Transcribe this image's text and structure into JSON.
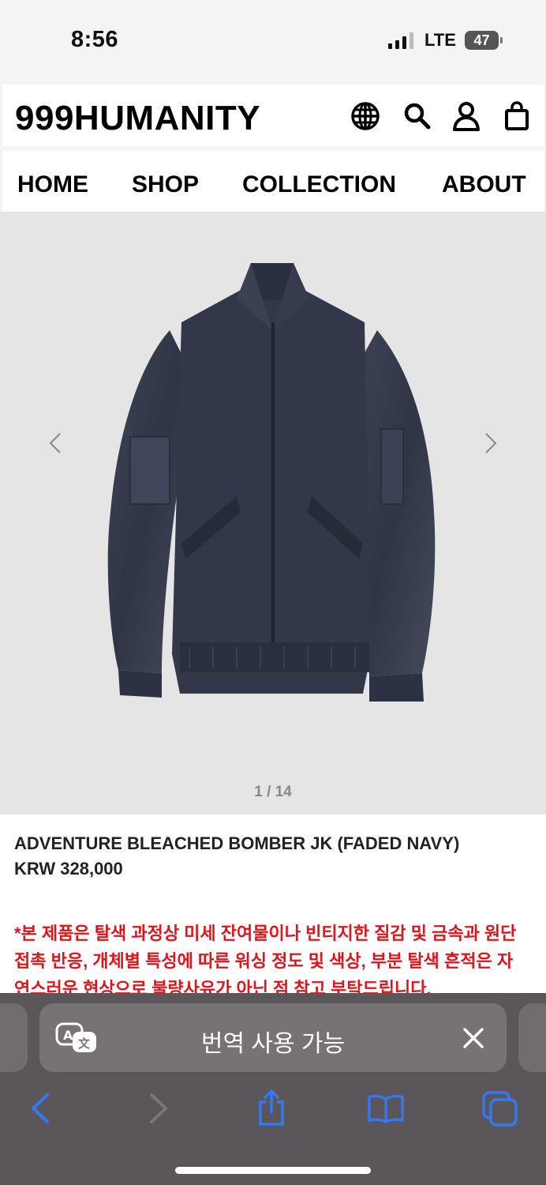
{
  "status": {
    "time": "8:56",
    "network": "LTE",
    "battery": "47"
  },
  "header": {
    "logo": "999HUMANITY",
    "icons": [
      "globe-icon",
      "search-icon",
      "account-icon",
      "bag-icon"
    ]
  },
  "nav": {
    "items": [
      "HOME",
      "SHOP",
      "COLLECTION",
      "ABOUT"
    ]
  },
  "gallery": {
    "pager": "1 / 14",
    "image": "navy bomber jacket product photo"
  },
  "product": {
    "title": "ADVENTURE BLEACHED BOMBER JK (FADED NAVY)",
    "price": "KRW 328,000",
    "notice": "*본 제품은 탈색 과정상 미세 잔여물이나 빈티지한 질감 및 금속과 원단 접촉 반응, 개체별 특성에 따른 워싱 정도 및 색상, 부분 탈색 흔적은 자연스러운 현상으로 불량사유가 아닌 점 참고 부탁드립니다."
  },
  "browser": {
    "translate_label": "번역 사용 가능",
    "toolbar_icons": [
      "back-icon",
      "forward-icon",
      "share-icon",
      "bookmarks-icon",
      "tabs-icon"
    ],
    "accent_color": "#3478f6"
  }
}
